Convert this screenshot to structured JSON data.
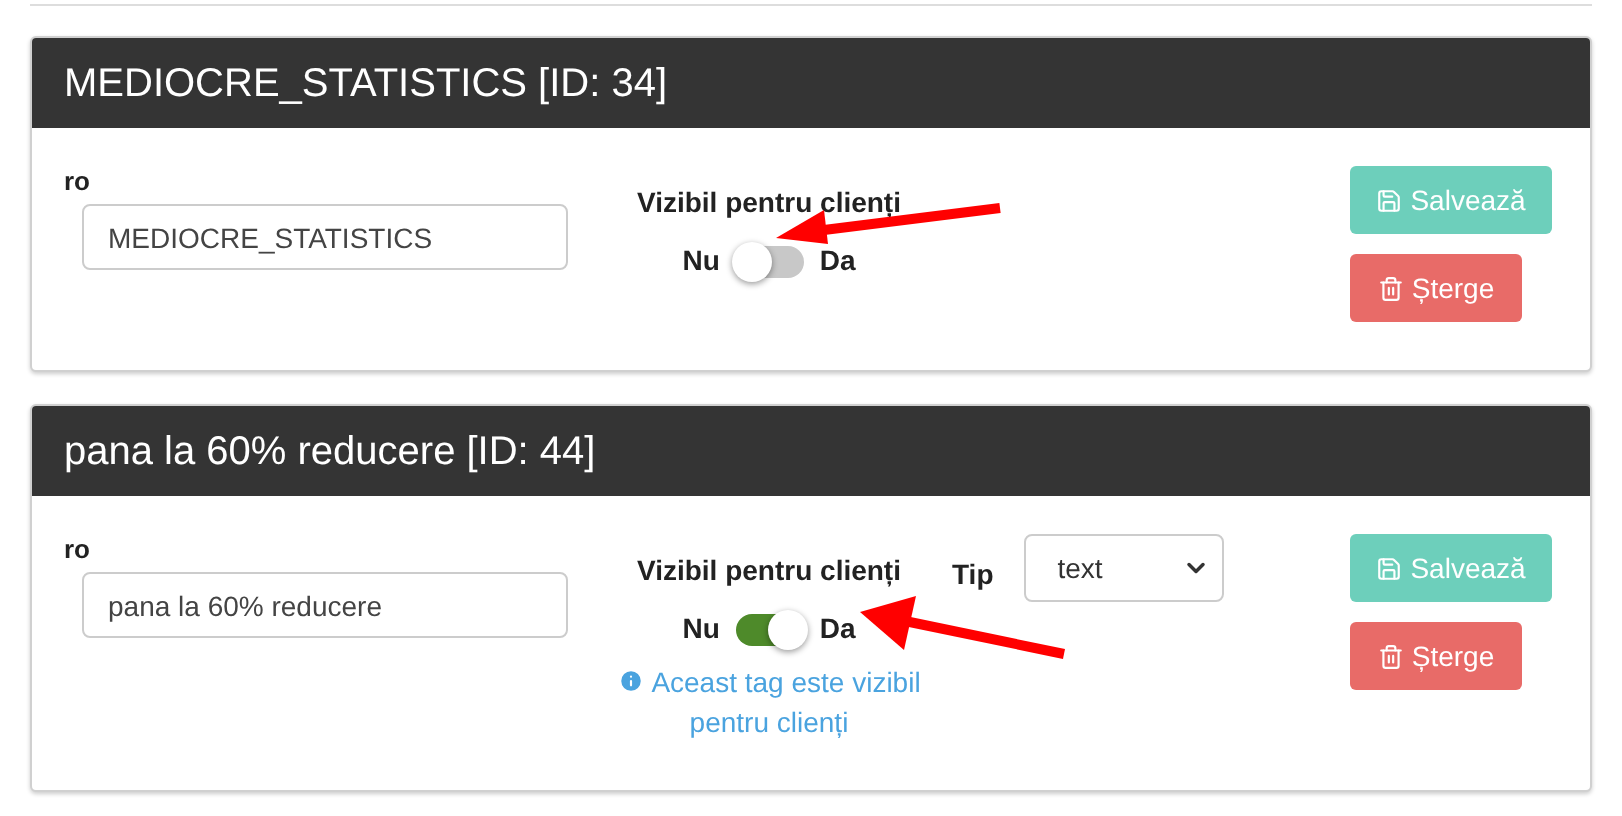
{
  "cards": [
    {
      "title": "MEDIOCRE_STATISTICS [ID: 34]",
      "language_label": "ro",
      "name_value": "MEDIOCRE_STATISTICS",
      "visibility_label": "Vizibil pentru clienți",
      "off_label": "Nu",
      "on_label": "Da",
      "visible": false,
      "save_button": "Salvează",
      "delete_button": "Șterge"
    },
    {
      "title": "pana la 60% reducere [ID: 44]",
      "language_label": "ro",
      "name_value": "pana la 60% reducere",
      "visibility_label": "Vizibil pentru clienți",
      "off_label": "Nu",
      "on_label": "Da",
      "visible": true,
      "info_text": "Aceast tag este vizibil pentru clienți",
      "type_label": "Tip",
      "type_value": "text",
      "save_button": "Salvează",
      "delete_button": "Șterge"
    }
  ]
}
